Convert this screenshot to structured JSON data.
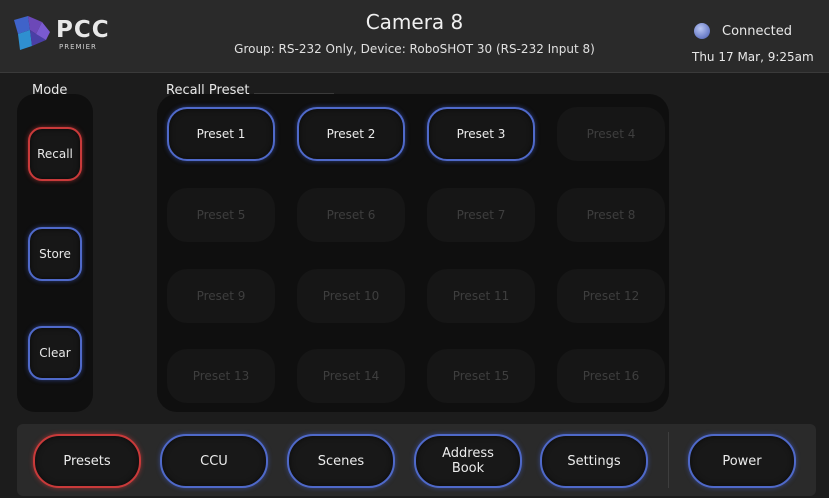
{
  "header": {
    "logo_text": "PCC",
    "logo_sub": "PREMIER",
    "title": "Camera 8",
    "subtitle": "Group: RS-232 Only,  Device: RoboSHOT 30 (RS-232 Input 8)",
    "status": "Connected",
    "datetime": "Thu 17 Mar, 9:25am"
  },
  "mode": {
    "label": "Mode",
    "buttons": [
      {
        "label": "Recall",
        "active": true
      },
      {
        "label": "Store",
        "active": false
      },
      {
        "label": "Clear",
        "active": false
      }
    ]
  },
  "presets": {
    "label": "Recall Preset",
    "items": [
      {
        "label": "Preset 1",
        "enabled": true
      },
      {
        "label": "Preset 2",
        "enabled": true
      },
      {
        "label": "Preset 3",
        "enabled": true
      },
      {
        "label": "Preset 4",
        "enabled": false
      },
      {
        "label": "Preset 5",
        "enabled": false
      },
      {
        "label": "Preset 6",
        "enabled": false
      },
      {
        "label": "Preset 7",
        "enabled": false
      },
      {
        "label": "Preset 8",
        "enabled": false
      },
      {
        "label": "Preset 9",
        "enabled": false
      },
      {
        "label": "Preset 10",
        "enabled": false
      },
      {
        "label": "Preset 11",
        "enabled": false
      },
      {
        "label": "Preset 12",
        "enabled": false
      },
      {
        "label": "Preset 13",
        "enabled": false
      },
      {
        "label": "Preset 14",
        "enabled": false
      },
      {
        "label": "Preset 15",
        "enabled": false
      },
      {
        "label": "Preset 16",
        "enabled": false
      }
    ]
  },
  "nav": {
    "items": [
      {
        "label": "Presets",
        "active": true
      },
      {
        "label": "CCU",
        "active": false
      },
      {
        "label": "Scenes",
        "active": false
      },
      {
        "label": "Address Book",
        "active": false
      },
      {
        "label": "Settings",
        "active": false
      },
      {
        "label": "Power",
        "active": false
      }
    ]
  },
  "colors": {
    "accent_blue": "#4f69c9",
    "active_red": "#c93a3a",
    "background": "#1c1c1c",
    "panel": "#0f0f0f"
  }
}
